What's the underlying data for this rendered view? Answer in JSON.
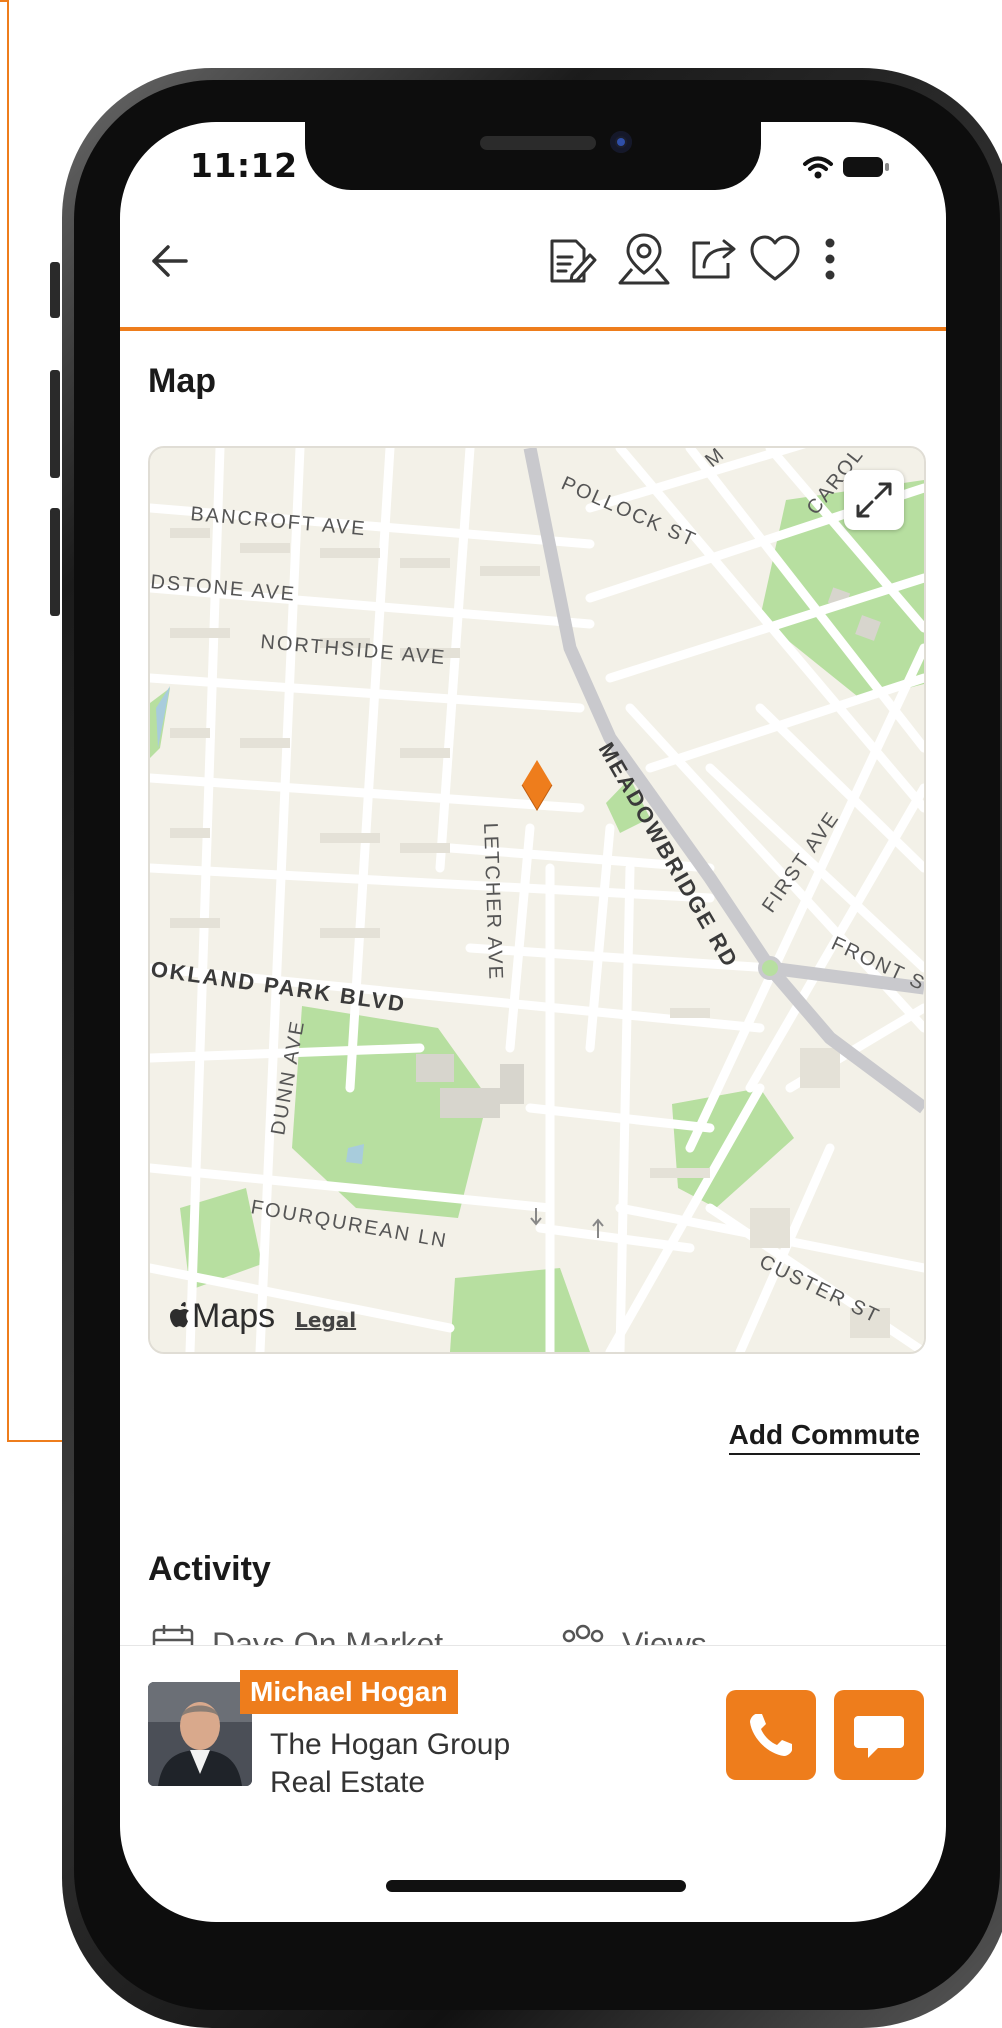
{
  "status": {
    "time": "11:12"
  },
  "header": {
    "back_icon": "arrow-left-icon",
    "actions": [
      "document-edit-icon",
      "map-pin-icon",
      "share-icon",
      "heart-icon",
      "more-vertical-icon"
    ]
  },
  "map_section": {
    "title": "Map",
    "expand_icon": "expand-icon",
    "provider": "Maps",
    "legal": "Legal",
    "labels": {
      "bancroft": "BANCROFT AVE",
      "dstone": "DSTONE AVE",
      "northside": "NORTHSIDE AVE",
      "pollock": "POLLOCK ST",
      "carol": "CAROL",
      "m": "M",
      "meadowbridge": "MEADOWBRIDGE RD",
      "letcher": "LETCHER AVE",
      "first": "FIRST AVE",
      "front": "FRONT S",
      "okland": "OKLAND PARK BLVD",
      "dunn": "DUNN AVE",
      "fourqurean": "FOURQUREAN LN",
      "custer": "CUSTER ST"
    }
  },
  "commute": {
    "label": "Add Commute"
  },
  "activity": {
    "title": "Activity",
    "items": [
      {
        "icon": "calendar-icon",
        "label": "Days On Market"
      },
      {
        "icon": "people-icon",
        "label": "Views"
      }
    ]
  },
  "agent": {
    "name": "Michael Hogan",
    "company_line1": "The Hogan Group",
    "company_line2": "Real Estate",
    "call_icon": "phone-icon",
    "chat_icon": "chat-bubble-icon"
  },
  "colors": {
    "accent": "#ee7d1c",
    "park": "#b7dfa0",
    "road": "#ffffff",
    "land": "#f3f1e8"
  }
}
